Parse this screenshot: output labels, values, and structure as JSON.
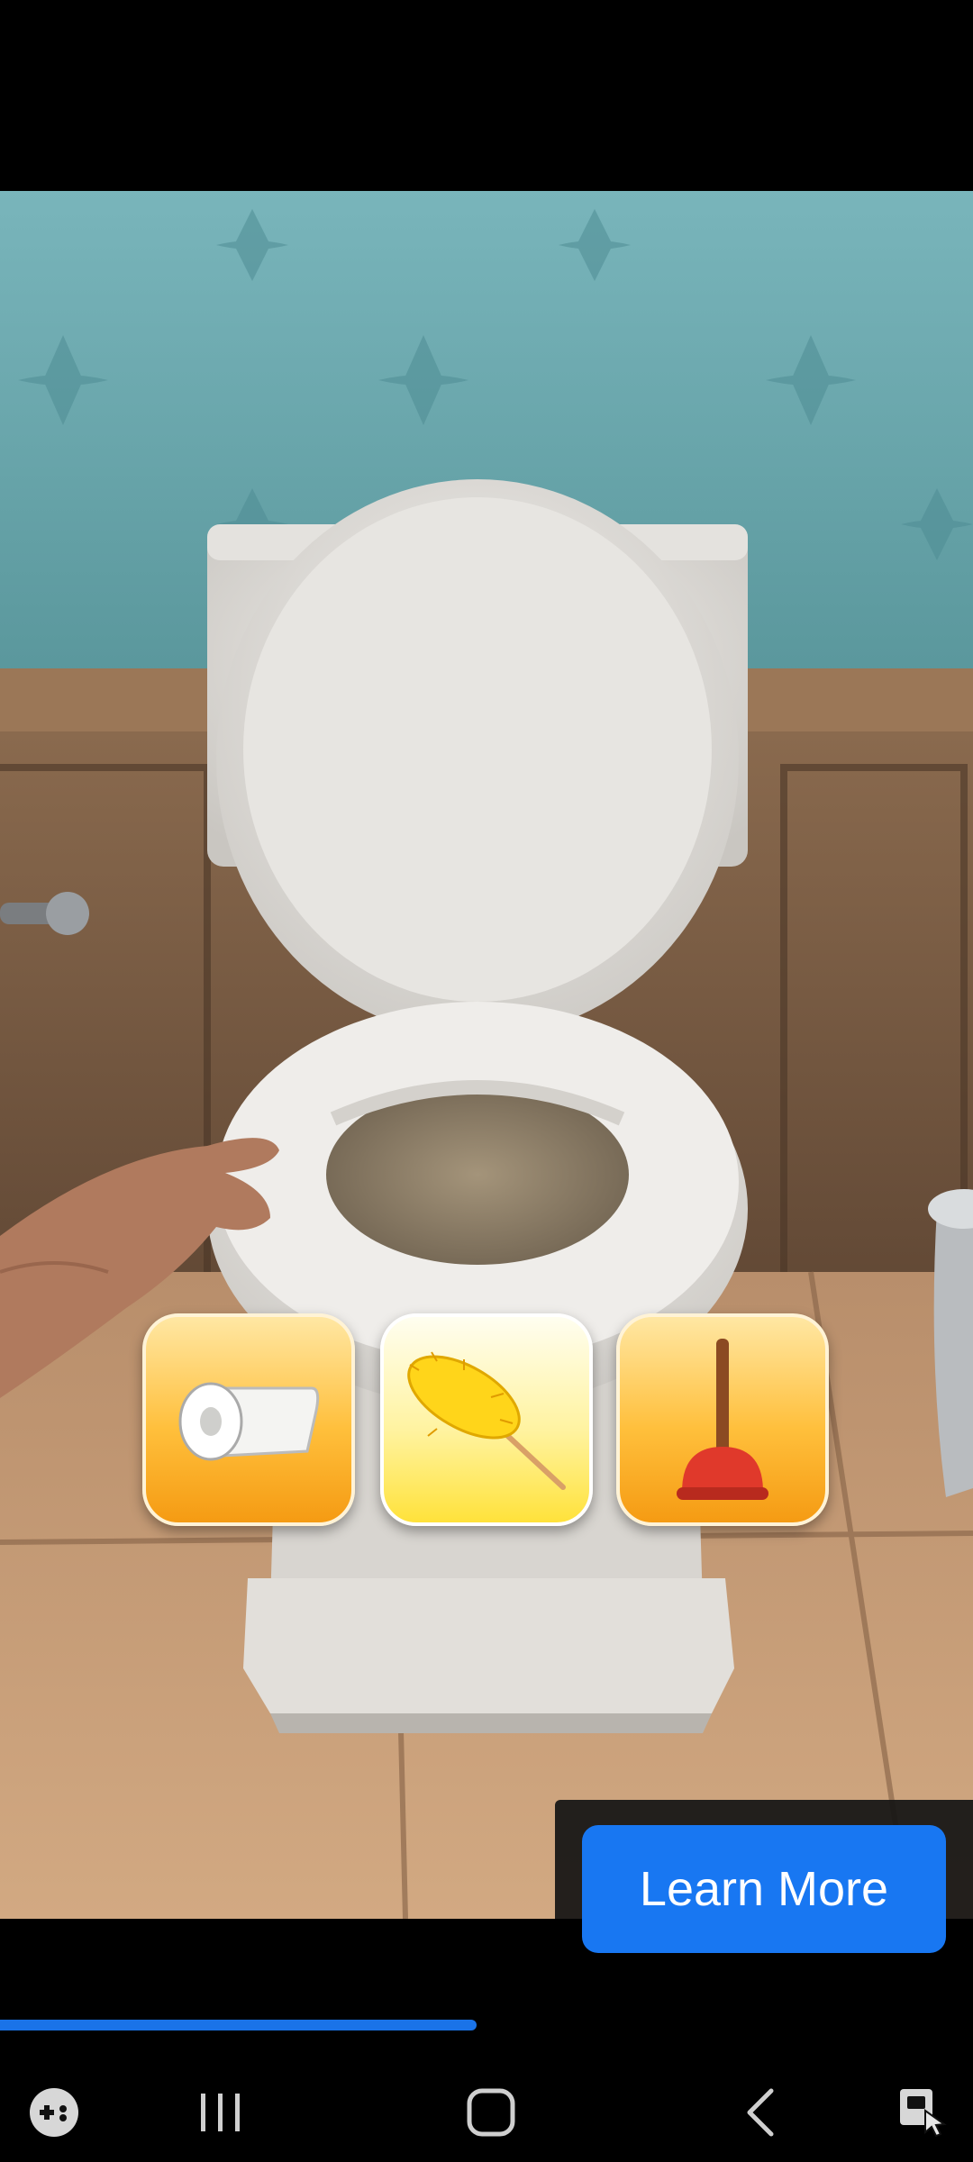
{
  "game": {
    "tools": [
      {
        "name": "toilet-paper",
        "icon": "toilet-paper-icon",
        "selected": false
      },
      {
        "name": "feather-duster",
        "icon": "feather-duster-icon",
        "selected": true
      },
      {
        "name": "plunger",
        "icon": "plunger-icon",
        "selected": false
      }
    ]
  },
  "ad": {
    "cta_label": "Learn More",
    "progress_fraction": 0.49
  },
  "navbar": {
    "items": [
      "game-launcher-icon",
      "recent-apps-icon",
      "home-icon",
      "back-icon",
      "screenshot-assist-icon"
    ]
  },
  "colors": {
    "cta": "#1877f2",
    "progress": "#1a73e8",
    "wallpaper": "#6aaab0",
    "tool_orange": "#ffbf3b",
    "tool_yellow": "#fff3a0"
  }
}
